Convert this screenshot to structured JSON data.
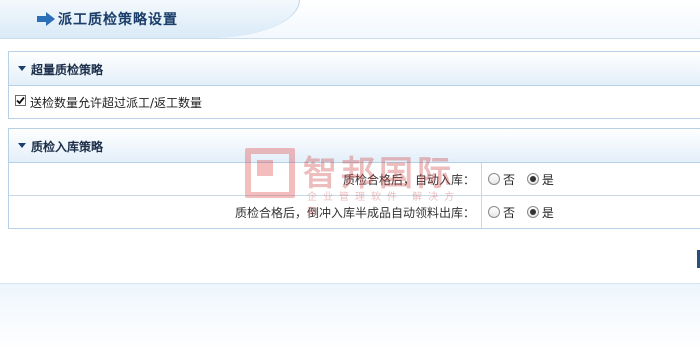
{
  "header": {
    "title": "派工质检策略设置",
    "icon": "arrow-right-icon"
  },
  "sections": [
    {
      "title": "超量质检策略",
      "checkbox": {
        "label": "送检数量允许超过派工/返工数量",
        "checked": true
      }
    },
    {
      "title": "质检入库策略",
      "rows": [
        {
          "label": "质检合格后，自动入库：",
          "options": [
            "否",
            "是"
          ],
          "selected": "是"
        },
        {
          "label": "质检合格后，倒冲入库半成品自动领料出库：",
          "options": [
            "否",
            "是"
          ],
          "selected": "是"
        }
      ]
    }
  ],
  "watermark": {
    "text": "智邦国际",
    "sub": "企业管理软件 解决方案"
  },
  "colors": {
    "accent": "#1b3d6a",
    "border": "#b7d0e6",
    "watermark": "#cc4444"
  }
}
